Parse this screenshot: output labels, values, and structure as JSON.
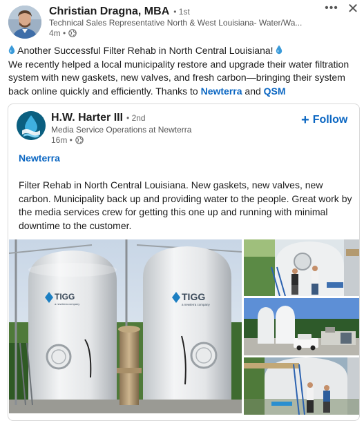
{
  "post": {
    "author": {
      "name": "Christian Dragna, MBA",
      "degree": "• 1st",
      "headline": "Technical Sales Representative North & West Louisiana- Water/Wa...",
      "time": "4m •"
    },
    "actions": {
      "more_label": "•••",
      "close_label": "✕"
    },
    "text": {
      "line1": "Another Successful Filter Rehab in North Central Louisiana!",
      "body": "We recently helped a local municipality restore and upgrade their water filtration system with new gaskets, new valves, and fresh carbon—bringing their system back online quickly and efficiently. Thanks to",
      "mention1": "Newterra",
      "and": "and",
      "mention2": "QSM"
    }
  },
  "shared_post": {
    "author": {
      "name": "H.W. Harter III",
      "degree": "• 2nd",
      "headline": "Media Service Operations at Newterra",
      "time": "16m •"
    },
    "follow_label": "Follow",
    "follow_icon": "plus-icon",
    "hashtag": "Newterra",
    "text": "Filter Rehab in North Central Louisiana. New gaskets, new valves, new carbon. Municipality back up and providing water to the people. Great work by the media services crew for getting this one up and running with minimal downtime to the customer.",
    "photos": {
      "main_tank_brand": "TIGG",
      "main_tank_sub": "a newterra company"
    }
  },
  "colors": {
    "link": "#0a66c2",
    "text": "#1d1d1d",
    "muted": "#666666",
    "water_drop": "#3a9ad9"
  },
  "icons": [
    "globe-icon",
    "water-drop-icon",
    "plus-icon",
    "more-icon",
    "close-icon"
  ]
}
